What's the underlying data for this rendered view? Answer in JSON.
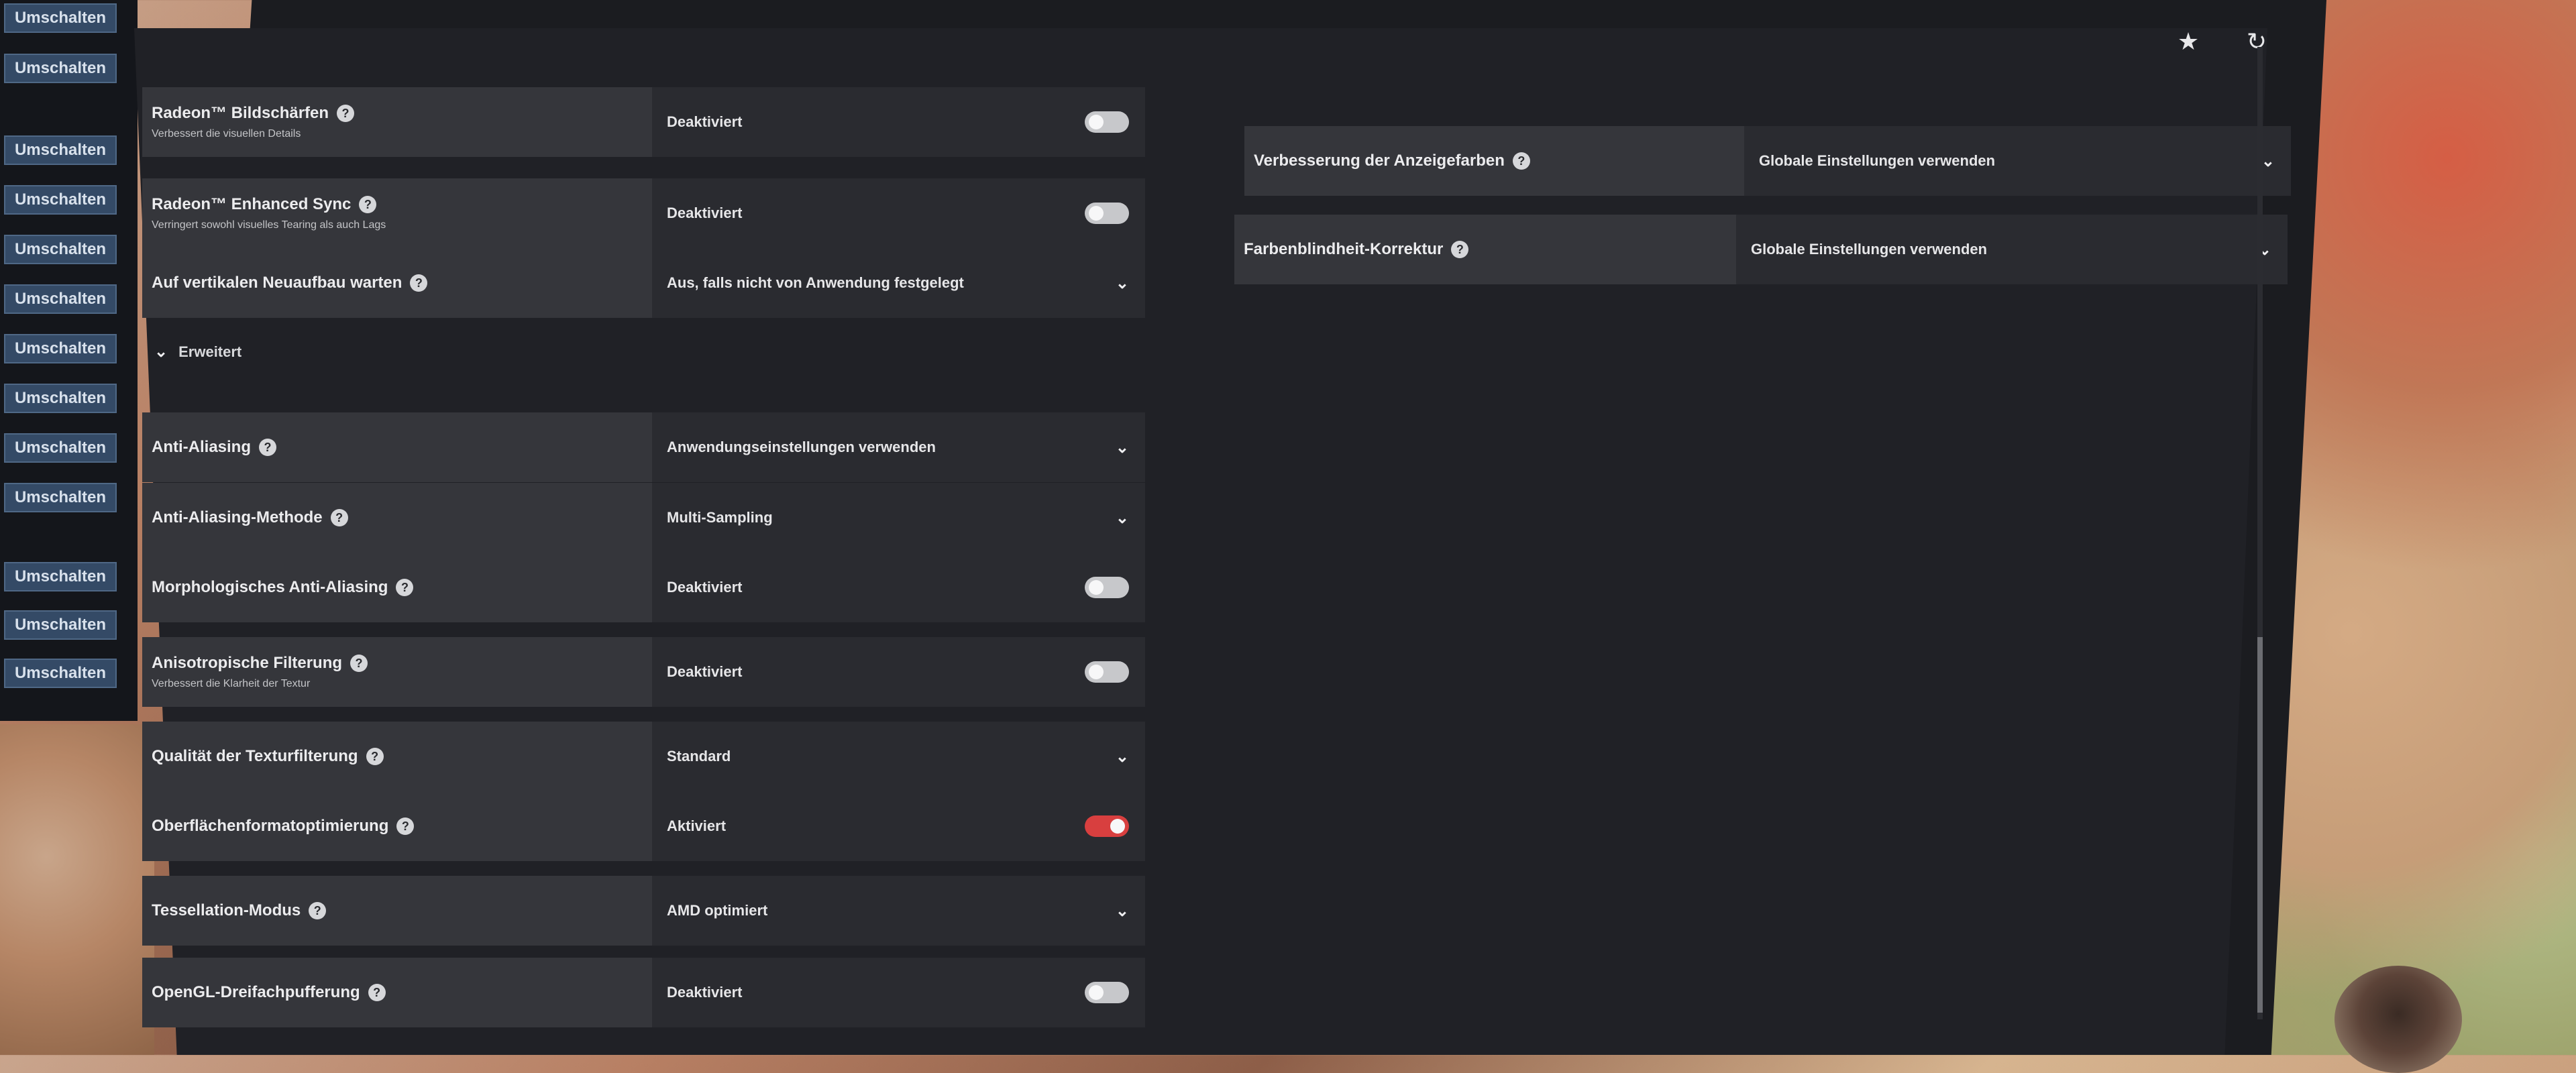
{
  "sidebar": {
    "buttons": [
      "Umschalten",
      "Umschalten",
      "Umschalten",
      "Umschalten",
      "Umschalten",
      "Umschalten",
      "Umschalten",
      "Umschalten",
      "Umschalten",
      "Umschalten",
      "Umschalten",
      "Umschalten",
      "Umschalten"
    ]
  },
  "toolbar": {
    "favorite_icon": "star-icon",
    "reset_icon": "reset-icon"
  },
  "left_settings": [
    {
      "label": "Radeon™ Bildschärfen",
      "subtitle": "Verbessert die visuellen Details",
      "value": "Deaktiviert",
      "control": "toggle",
      "state": "off"
    },
    {
      "label": "Radeon™ Enhanced Sync",
      "subtitle": "Verringert sowohl visuelles Tearing als auch Lags",
      "value": "Deaktiviert",
      "control": "toggle",
      "state": "off"
    },
    {
      "label": "Auf vertikalen Neuaufbau warten",
      "subtitle": "",
      "value": "Aus, falls nicht von Anwendung festgelegt",
      "control": "dropdown"
    }
  ],
  "advanced": {
    "label": "Erweitert",
    "settings": [
      {
        "label": "Anti-Aliasing",
        "subtitle": "",
        "value": "Anwendungseinstellungen verwenden",
        "control": "dropdown"
      },
      {
        "label": "Anti-Aliasing-Methode",
        "subtitle": "",
        "value": "Multi-Sampling",
        "control": "dropdown"
      },
      {
        "label": "Morphologisches Anti-Aliasing",
        "subtitle": "",
        "value": "Deaktiviert",
        "control": "toggle",
        "state": "off"
      },
      {
        "label": "Anisotropische Filterung",
        "subtitle": "Verbessert die Klarheit der Textur",
        "value": "Deaktiviert",
        "control": "toggle",
        "state": "off"
      },
      {
        "label": "Qualität der Texturfilterung",
        "subtitle": "",
        "value": "Standard",
        "control": "dropdown"
      },
      {
        "label": "Oberflächenformatoptimierung",
        "subtitle": "",
        "value": "Aktiviert",
        "control": "toggle",
        "state": "on"
      },
      {
        "label": "Tessellation-Modus",
        "subtitle": "",
        "value": "AMD optimiert",
        "control": "dropdown"
      },
      {
        "label": "OpenGL-Dreifachpufferung",
        "subtitle": "",
        "value": "Deaktiviert",
        "control": "toggle",
        "state": "off"
      }
    ]
  },
  "right_settings": [
    {
      "label": "Verbesserung der Anzeigefarben",
      "value": "Globale Einstellungen verwenden",
      "control": "dropdown"
    },
    {
      "label": "Farbenblindheit-Korrektur",
      "value": "Globale Einstellungen verwenden",
      "control": "dropdown"
    }
  ],
  "colors": {
    "accent_toggle_on": "#d83f3f",
    "sidebar_button": "#344a66",
    "panel_bg": "#202126"
  }
}
